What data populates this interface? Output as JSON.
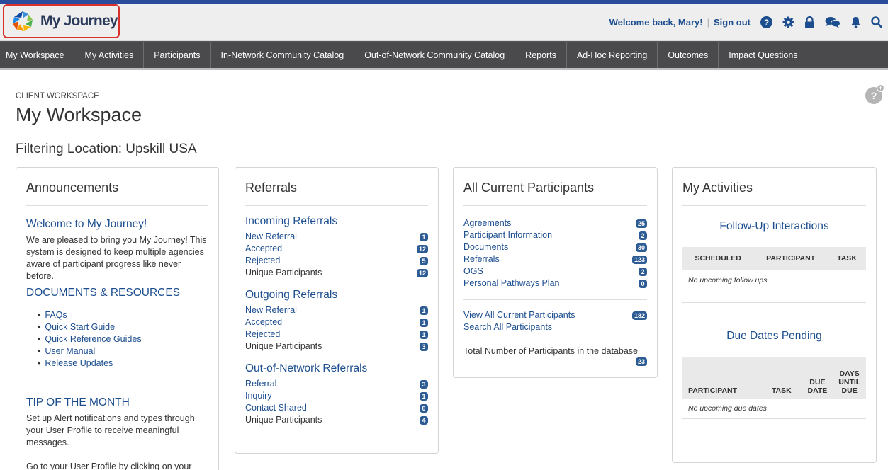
{
  "header": {
    "logo_text": "My Journey",
    "welcome": "Welcome back, Mary!",
    "signout": "Sign out"
  },
  "nav": [
    "My Workspace",
    "My Activities",
    "Participants",
    "In-Network Community Catalog",
    "Out-of-Network Community Catalog",
    "Reports",
    "Ad-Hoc Reporting",
    "Outcomes",
    "Impact Questions"
  ],
  "page": {
    "kicker": "CLIENT WORKSPACE",
    "title": "My Workspace",
    "filter": "Filtering Location: Upskill USA"
  },
  "announcements": {
    "title": "Announcements",
    "welcome_heading": "Welcome to My Journey!",
    "welcome_body": "We are pleased to bring you My Journey! This system is designed to keep multiple agencies aware of participant progress like never before.",
    "docs_heading": "DOCUMENTS & RESOURCES",
    "docs": [
      "FAQs",
      "Quick Start Guide",
      "Quick Reference Guides",
      "User Manual",
      "Release Updates"
    ],
    "tip_heading": "TIP OF THE MONTH",
    "tip_p1": "Set up Alert notifications and types through your User Profile to receive meaningful messages.",
    "tip_p2": "Go to your User Profile by clicking on your name in the upper right portion of your screen."
  },
  "referrals": {
    "title": "Referrals",
    "incoming_title": "Incoming Referrals",
    "incoming": [
      {
        "label": "New Referral",
        "count": "1"
      },
      {
        "label": "Accepted",
        "count": "12"
      },
      {
        "label": "Rejected",
        "count": "5"
      },
      {
        "label": "Unique Participants",
        "count": "12"
      }
    ],
    "outgoing_title": "Outgoing Referrals",
    "outgoing": [
      {
        "label": "New Referral",
        "count": "1"
      },
      {
        "label": "Accepted",
        "count": "1"
      },
      {
        "label": "Rejected",
        "count": "1"
      },
      {
        "label": "Unique Participants",
        "count": "3"
      }
    ],
    "oon_title": "Out-of-Network Referrals",
    "oon": [
      {
        "label": "Referral",
        "count": "3"
      },
      {
        "label": "Inquiry",
        "count": "1"
      },
      {
        "label": "Contact Shared",
        "count": "0"
      },
      {
        "label": "Unique Participants",
        "count": "4"
      }
    ]
  },
  "participants": {
    "title": "All Current Participants",
    "items": [
      {
        "label": "Agreements",
        "count": "25"
      },
      {
        "label": "Participant Information",
        "count": "2"
      },
      {
        "label": "Documents",
        "count": "30"
      },
      {
        "label": "Referrals",
        "count": "123"
      },
      {
        "label": "OGS",
        "count": "2"
      },
      {
        "label": "Personal Pathways Plan",
        "count": "0"
      }
    ],
    "view_all": "View All Current Participants",
    "view_all_count": "182",
    "search_all": "Search All Participants",
    "total_label": "Total Number of Participants in the database",
    "total_count": "23"
  },
  "activities": {
    "title": "My Activities",
    "followup_title": "Follow-Up Interactions",
    "followup_cols": [
      "SCHEDULED",
      "PARTICIPANT",
      "TASK"
    ],
    "followup_empty": "No upcoming follow ups",
    "due_title": "Due Dates Pending",
    "due_cols": [
      "PARTICIPANT",
      "TASK",
      "DUE DATE",
      "DAYS UNTIL DUE"
    ],
    "due_empty": "No upcoming due dates"
  }
}
